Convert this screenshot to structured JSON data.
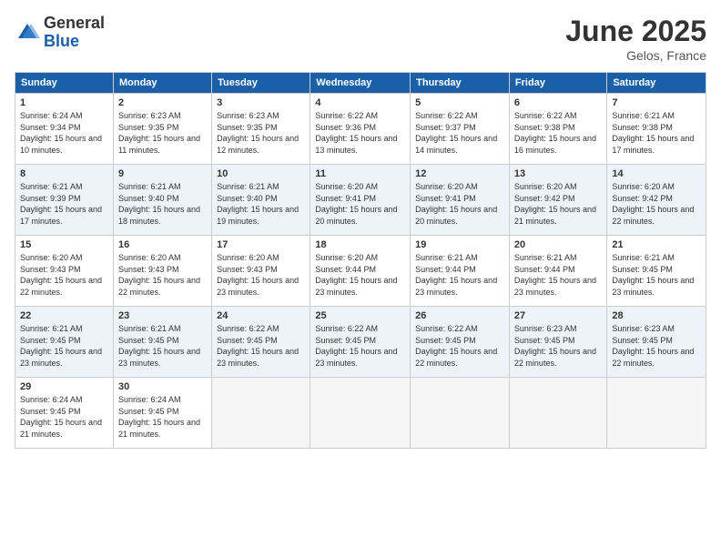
{
  "logo": {
    "general": "General",
    "blue": "Blue"
  },
  "title": "June 2025",
  "location": "Gelos, France",
  "days_header": [
    "Sunday",
    "Monday",
    "Tuesday",
    "Wednesday",
    "Thursday",
    "Friday",
    "Saturday"
  ],
  "weeks": [
    [
      {
        "day": "1",
        "sunrise": "6:24 AM",
        "sunset": "9:34 PM",
        "daylight": "15 hours and 10 minutes."
      },
      {
        "day": "2",
        "sunrise": "6:23 AM",
        "sunset": "9:35 PM",
        "daylight": "15 hours and 11 minutes."
      },
      {
        "day": "3",
        "sunrise": "6:23 AM",
        "sunset": "9:35 PM",
        "daylight": "15 hours and 12 minutes."
      },
      {
        "day": "4",
        "sunrise": "6:22 AM",
        "sunset": "9:36 PM",
        "daylight": "15 hours and 13 minutes."
      },
      {
        "day": "5",
        "sunrise": "6:22 AM",
        "sunset": "9:37 PM",
        "daylight": "15 hours and 14 minutes."
      },
      {
        "day": "6",
        "sunrise": "6:22 AM",
        "sunset": "9:38 PM",
        "daylight": "15 hours and 16 minutes."
      },
      {
        "day": "7",
        "sunrise": "6:21 AM",
        "sunset": "9:38 PM",
        "daylight": "15 hours and 17 minutes."
      }
    ],
    [
      {
        "day": "8",
        "sunrise": "6:21 AM",
        "sunset": "9:39 PM",
        "daylight": "15 hours and 17 minutes."
      },
      {
        "day": "9",
        "sunrise": "6:21 AM",
        "sunset": "9:40 PM",
        "daylight": "15 hours and 18 minutes."
      },
      {
        "day": "10",
        "sunrise": "6:21 AM",
        "sunset": "9:40 PM",
        "daylight": "15 hours and 19 minutes."
      },
      {
        "day": "11",
        "sunrise": "6:20 AM",
        "sunset": "9:41 PM",
        "daylight": "15 hours and 20 minutes."
      },
      {
        "day": "12",
        "sunrise": "6:20 AM",
        "sunset": "9:41 PM",
        "daylight": "15 hours and 20 minutes."
      },
      {
        "day": "13",
        "sunrise": "6:20 AM",
        "sunset": "9:42 PM",
        "daylight": "15 hours and 21 minutes."
      },
      {
        "day": "14",
        "sunrise": "6:20 AM",
        "sunset": "9:42 PM",
        "daylight": "15 hours and 22 minutes."
      }
    ],
    [
      {
        "day": "15",
        "sunrise": "6:20 AM",
        "sunset": "9:43 PM",
        "daylight": "15 hours and 22 minutes."
      },
      {
        "day": "16",
        "sunrise": "6:20 AM",
        "sunset": "9:43 PM",
        "daylight": "15 hours and 22 minutes."
      },
      {
        "day": "17",
        "sunrise": "6:20 AM",
        "sunset": "9:43 PM",
        "daylight": "15 hours and 23 minutes."
      },
      {
        "day": "18",
        "sunrise": "6:20 AM",
        "sunset": "9:44 PM",
        "daylight": "15 hours and 23 minutes."
      },
      {
        "day": "19",
        "sunrise": "6:21 AM",
        "sunset": "9:44 PM",
        "daylight": "15 hours and 23 minutes."
      },
      {
        "day": "20",
        "sunrise": "6:21 AM",
        "sunset": "9:44 PM",
        "daylight": "15 hours and 23 minutes."
      },
      {
        "day": "21",
        "sunrise": "6:21 AM",
        "sunset": "9:45 PM",
        "daylight": "15 hours and 23 minutes."
      }
    ],
    [
      {
        "day": "22",
        "sunrise": "6:21 AM",
        "sunset": "9:45 PM",
        "daylight": "15 hours and 23 minutes."
      },
      {
        "day": "23",
        "sunrise": "6:21 AM",
        "sunset": "9:45 PM",
        "daylight": "15 hours and 23 minutes."
      },
      {
        "day": "24",
        "sunrise": "6:22 AM",
        "sunset": "9:45 PM",
        "daylight": "15 hours and 23 minutes."
      },
      {
        "day": "25",
        "sunrise": "6:22 AM",
        "sunset": "9:45 PM",
        "daylight": "15 hours and 23 minutes."
      },
      {
        "day": "26",
        "sunrise": "6:22 AM",
        "sunset": "9:45 PM",
        "daylight": "15 hours and 22 minutes."
      },
      {
        "day": "27",
        "sunrise": "6:23 AM",
        "sunset": "9:45 PM",
        "daylight": "15 hours and 22 minutes."
      },
      {
        "day": "28",
        "sunrise": "6:23 AM",
        "sunset": "9:45 PM",
        "daylight": "15 hours and 22 minutes."
      }
    ],
    [
      {
        "day": "29",
        "sunrise": "6:24 AM",
        "sunset": "9:45 PM",
        "daylight": "15 hours and 21 minutes."
      },
      {
        "day": "30",
        "sunrise": "6:24 AM",
        "sunset": "9:45 PM",
        "daylight": "15 hours and 21 minutes."
      },
      null,
      null,
      null,
      null,
      null
    ]
  ],
  "labels": {
    "sunrise": "Sunrise:",
    "sunset": "Sunset:",
    "daylight": "Daylight:"
  }
}
